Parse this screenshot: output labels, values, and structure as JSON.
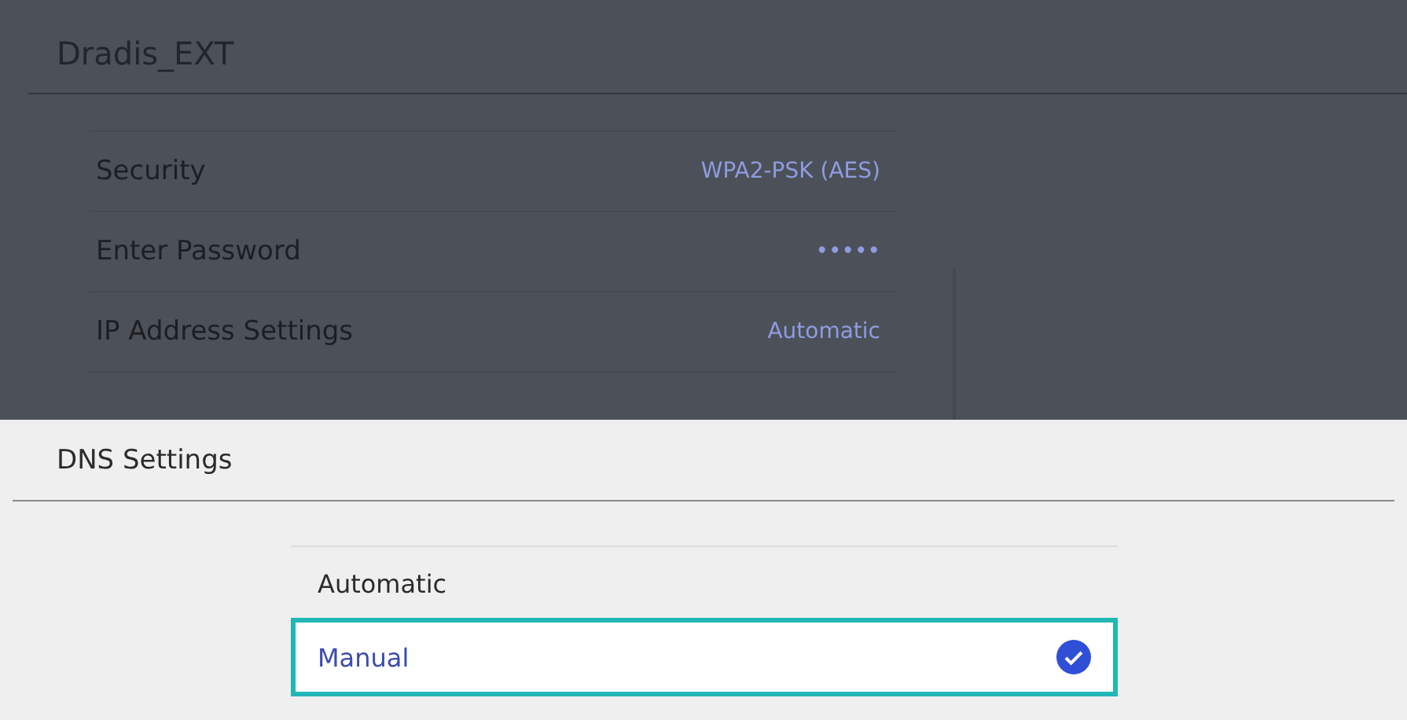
{
  "title": "Dradis_EXT",
  "settings": [
    {
      "label": "Security",
      "value": "WPA2-PSK (AES)"
    },
    {
      "label": "Enter Password",
      "value": "•••••"
    },
    {
      "label": "IP Address Settings",
      "value": "Automatic"
    }
  ],
  "dialog": {
    "title": "DNS Settings",
    "options": [
      {
        "label": "Automatic",
        "selected": false
      },
      {
        "label": "Manual",
        "selected": true
      }
    ]
  }
}
